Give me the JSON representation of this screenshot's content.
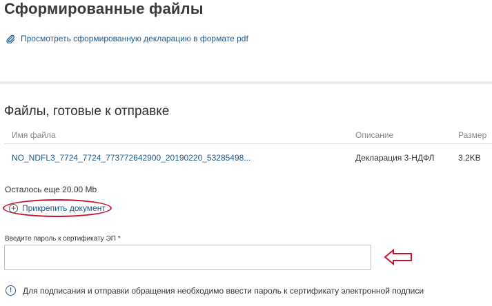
{
  "page": {
    "title": "Сформированные файлы",
    "pdf_link": "Просмотреть сформированную декларацию в формате pdf"
  },
  "files_section": {
    "title": "Файлы, готовые к отправке",
    "columns": {
      "name": "Имя файла",
      "description": "Описание",
      "size": "Размер"
    },
    "rows": [
      {
        "name": "NO_NDFL3_7724_7724_773772642900_20190220_53285498...",
        "description": "Декларация 3-НДФЛ",
        "size": "3.2KB"
      }
    ],
    "remaining": "Осталось еще 20.00 Mb",
    "attach_label": "Прикрепить документ"
  },
  "password": {
    "label": "Введите пароль к сертификату ЭП *",
    "value": "",
    "placeholder": ""
  },
  "notice": {
    "text": "Для подписания и отправки обращения необходимо ввести пароль к сертификату электронной подписи"
  },
  "colors": {
    "link": "#1f5a8c",
    "annotation": "#c8102e",
    "divider": "#ececec"
  },
  "icons": {
    "pdf_link": "paperclip-icon",
    "attach": "plus-circle-icon",
    "notice": "info-icon",
    "annotation": "arrow-left-icon"
  }
}
